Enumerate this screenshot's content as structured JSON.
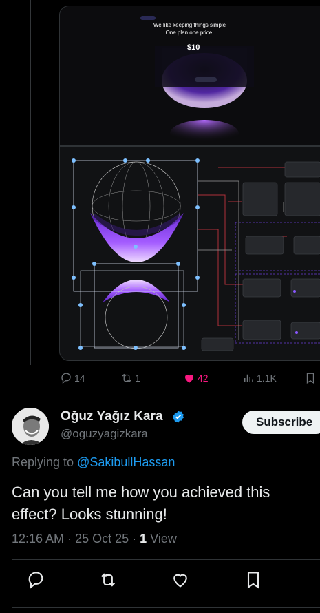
{
  "media_top": {
    "heading_line1": "We like keeping things simple",
    "heading_line2": "One plan one price.",
    "price": "$10"
  },
  "tweet_actions": {
    "replies": "14",
    "reposts": "1",
    "likes": "42",
    "views": "1.1K"
  },
  "reply": {
    "author_name": "Oğuz Yağız Kara",
    "author_handle": "@oguzyagizkara",
    "subscribe_label": "Subscribe",
    "replying_prefix": "Replying to",
    "replying_to": "@SakibullHassan",
    "text": "Can you tell me how you achieved this effect? Looks stunning!",
    "time": "12:16 AM",
    "date": "25 Oct 25",
    "views_count": "1",
    "views_label": "View"
  },
  "icons": [
    "reply-icon",
    "repost-icon",
    "like-icon",
    "views-icon",
    "bookmark-icon",
    "verified-icon"
  ],
  "colors": {
    "background": "#000000",
    "like": "#f91880",
    "link": "#1d9bf0",
    "verified": "#1d9bf0",
    "muted": "#71767b"
  }
}
